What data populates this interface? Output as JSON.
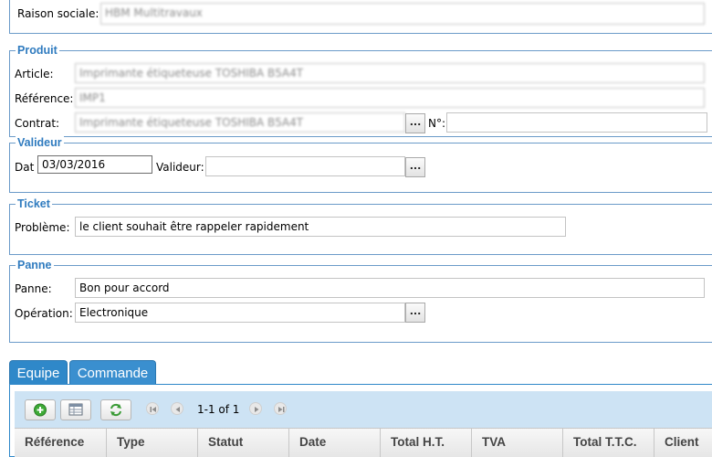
{
  "company": {
    "label": "Raison sociale:",
    "value": "HBM Multitravaux"
  },
  "produit": {
    "legend": "Produit",
    "article_label": "Article:",
    "article_value": "Imprimante étiqueteuse TOSHIBA B5A4T",
    "reference_label": "Référence:",
    "reference_value": "IMP1",
    "contrat_label": "Contrat:",
    "contrat_value": "Imprimante étiqueteuse TOSHIBA B5A4T",
    "contrat_btn": "...",
    "numero_label": "N°:",
    "numero_value": ""
  },
  "valideur": {
    "legend": "Valideur",
    "date_label": "Dat",
    "date_value": "03/03/2016",
    "valideur_label": "Valideur:",
    "valideur_value": "",
    "valideur_btn": "..."
  },
  "ticket": {
    "legend": "Ticket",
    "probleme_label": "Problème:",
    "probleme_value": "le client souhait être rappeler rapidement"
  },
  "panne": {
    "legend": "Panne",
    "panne_label": "Panne:",
    "panne_value": "Bon pour accord",
    "operation_label": "Opération:",
    "operation_value": "Electronique",
    "operation_btn": "..."
  },
  "tabs": [
    {
      "label": "Equipe",
      "active": true
    },
    {
      "label": "Commande",
      "active": false
    }
  ],
  "toolbar": {
    "add_icon": "add-circle-icon",
    "table_icon": "table-icon",
    "refresh_icon": "refresh-icon",
    "pager_text": "1-1 of 1"
  },
  "grid": {
    "columns": [
      "Référence",
      "Type",
      "Statut",
      "Date",
      "Total H.T.",
      "TVA",
      "Total T.T.C.",
      "Client"
    ]
  },
  "colors": {
    "accent": "#2f7bbf",
    "border": "#6b9bc9",
    "toolbar_bg": "#cde3f4"
  }
}
